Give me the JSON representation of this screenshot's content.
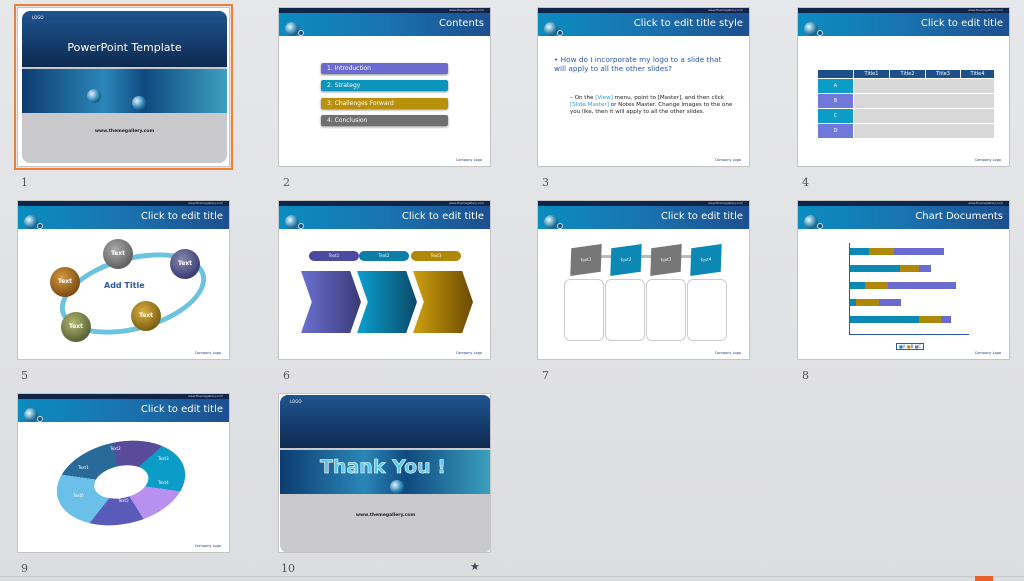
{
  "header_url": "www.themegallery.com",
  "footer": "Company Logo",
  "slides": [
    {
      "num": "1",
      "logo": "LOGO",
      "title": "PowerPoint Template",
      "url": "www.themegallery.com",
      "selected": true
    },
    {
      "num": "2",
      "title": "Contents",
      "items": [
        "1. Introduction",
        "2. Strategy",
        "3. Challenges Forward",
        "4. Conclusion"
      ],
      "item_colors": [
        "#6a6ad0",
        "#0d94bd",
        "#b8900a",
        "#707070"
      ]
    },
    {
      "num": "3",
      "title": "Click to edit title style",
      "bullet": "How do I incorporate my logo to a slide that will apply to all the other slides?",
      "sub_parts": [
        "On the ",
        "[View]",
        " menu, point to [Master], and then click ",
        "[Slide Master]",
        " or Notes Master. Change images to the one you like, then it will apply to all the other slides."
      ]
    },
    {
      "num": "4",
      "title": "Click to edit title",
      "columns": [
        "Title1",
        "Title2",
        "Title3",
        "Title4"
      ],
      "rows": [
        "A",
        "B",
        "C",
        "D"
      ]
    },
    {
      "num": "5",
      "title": "Click to edit title",
      "center": "Add Title",
      "bubbles": [
        "Text",
        "Text",
        "Text",
        "Text",
        "Text"
      ]
    },
    {
      "num": "6",
      "title": "Click to edit title",
      "labels": [
        "Text1",
        "Text2",
        "Text3"
      ]
    },
    {
      "num": "7",
      "title": "Click to edit title",
      "labels": [
        "Text1",
        "Text2",
        "Text3",
        "Text4"
      ]
    },
    {
      "num": "8",
      "title": "Chart Documents",
      "legend": [
        "A",
        "B",
        "C"
      ],
      "bars": [
        [
          15,
          20,
          40
        ],
        [
          40,
          15,
          10
        ],
        [
          12,
          18,
          55
        ],
        [
          5,
          18,
          18
        ],
        [
          55,
          18,
          8
        ]
      ]
    },
    {
      "num": "9",
      "title": "Click to edit title",
      "labels": [
        "Text1",
        "Text2",
        "Text3",
        "Text4",
        "Text5",
        "Text6"
      ]
    },
    {
      "num": "10",
      "logo": "LOGO",
      "title": "Thank You !",
      "url": "www.themegallery.com",
      "transition_icon": "star-icon"
    }
  ]
}
